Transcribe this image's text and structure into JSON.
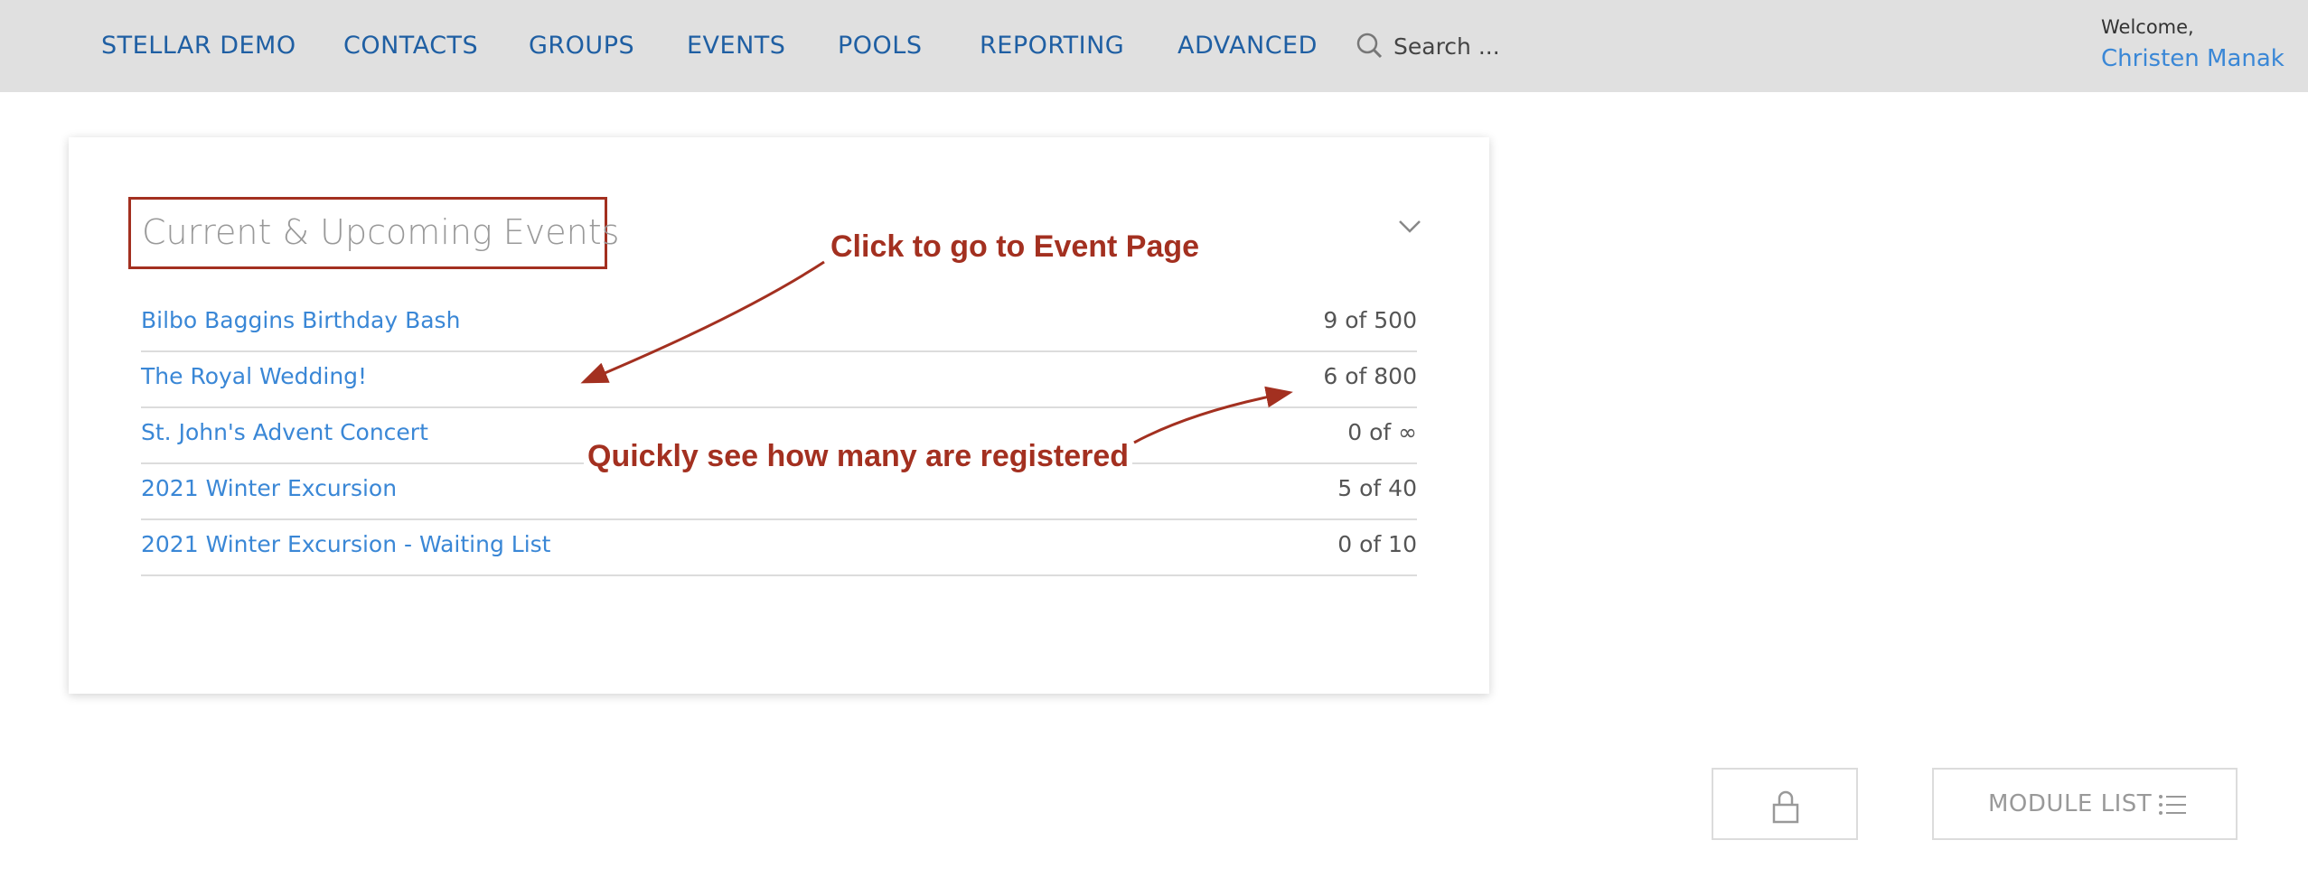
{
  "nav": {
    "items": [
      {
        "label": "STELLAR DEMO"
      },
      {
        "label": "CONTACTS"
      },
      {
        "label": "GROUPS"
      },
      {
        "label": "EVENTS"
      },
      {
        "label": "POOLS"
      },
      {
        "label": "REPORTING"
      },
      {
        "label": "ADVANCED"
      }
    ],
    "search_placeholder": "Search ..."
  },
  "user": {
    "welcome": "Welcome,",
    "name": "Christen Manak"
  },
  "card": {
    "title": "Current & Upcoming Events",
    "events": [
      {
        "name": "Bilbo Baggins Birthday Bash",
        "count": "9 of 500"
      },
      {
        "name": "The Royal Wedding!",
        "count": "6 of 800"
      },
      {
        "name": "St. John's Advent Concert",
        "count": "0 of ∞"
      },
      {
        "name": "2021 Winter Excursion",
        "count": "5 of 40"
      },
      {
        "name": "2021 Winter Excursion - Waiting List",
        "count": "0 of 10"
      }
    ]
  },
  "annotations": {
    "click_note": "Click to go to Event Page",
    "count_note": "Quickly see how many are registered"
  },
  "footer": {
    "module_list_label": "MODULE LIST"
  },
  "colors": {
    "nav_bg": "#e0e0e0",
    "nav_link": "#1f5fa3",
    "link": "#3a87d6",
    "annotation": "#a33020"
  }
}
